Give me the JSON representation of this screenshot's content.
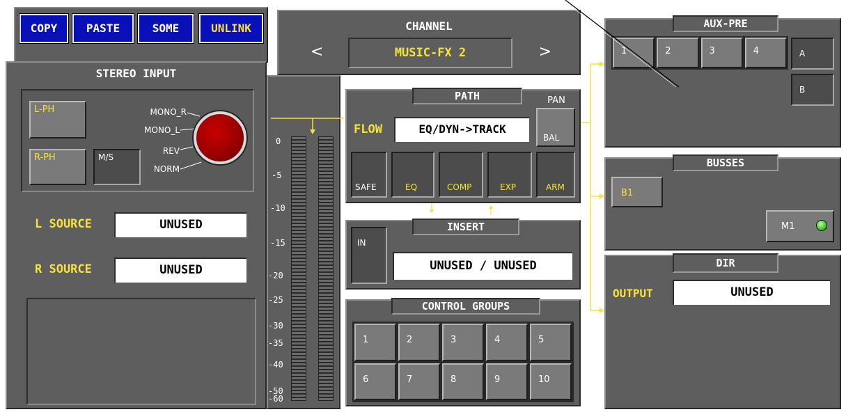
{
  "toolbar": {
    "copy": "COPY",
    "paste": "PASTE",
    "some": "SOME",
    "unlink": "UNLINK"
  },
  "stereo_input": {
    "title": "STEREO INPUT",
    "l_ph": "L-PH",
    "r_ph": "R-PH",
    "ms": "M/S",
    "knob_labels": [
      "MONO_R",
      "MONO_L",
      "REV",
      "NORM"
    ],
    "l_source_label": "L SOURCE",
    "l_source_value": "UNUSED",
    "r_source_label": "R SOURCE",
    "r_source_value": "UNUSED"
  },
  "channel": {
    "title": "CHANNEL",
    "name": "MUSIC-FX 2",
    "prev": "<",
    "next": ">"
  },
  "meter": {
    "scale": [
      "0",
      "-5",
      "-10",
      "-15",
      "-20",
      "-25",
      "-30",
      "-35",
      "-40",
      "-50",
      "-60"
    ]
  },
  "path": {
    "title": "PATH",
    "pan": "PAN",
    "bal": "BAL",
    "flow_label": "FLOW",
    "flow_value": "EQ/DYN->TRACK",
    "buttons": [
      "SAFE",
      "EQ",
      "COMP",
      "EXP",
      "ARM"
    ]
  },
  "insert": {
    "title": "INSERT",
    "in": "IN",
    "value": "UNUSED / UNUSED"
  },
  "control_groups": {
    "title": "CONTROL GROUPS",
    "buttons": [
      "1",
      "2",
      "3",
      "4",
      "5",
      "6",
      "7",
      "8",
      "9",
      "10"
    ]
  },
  "aux_pre": {
    "title": "AUX-PRE",
    "buttons": [
      "1",
      "2",
      "3",
      "4"
    ],
    "a": "A",
    "b": "B"
  },
  "busses": {
    "title": "BUSSES",
    "b1": "B1",
    "m1": "M1"
  },
  "dir": {
    "title": "DIR",
    "output_label": "OUTPUT",
    "output_value": "UNUSED"
  },
  "colors": {
    "accent": "#f6e23a",
    "panel": "#5e5e5e",
    "toolbar_blue": "#0a10b8",
    "knob_red": "#9a0000",
    "led_green": "#3ec82c"
  }
}
